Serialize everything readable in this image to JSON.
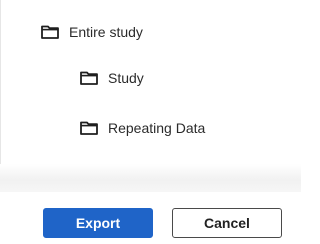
{
  "tree": {
    "items": [
      {
        "label": "Entire study",
        "icon": "folder-icon"
      },
      {
        "label": "Study",
        "icon": "folder-icon"
      },
      {
        "label": "Repeating Data",
        "icon": "folder-icon"
      }
    ]
  },
  "footer": {
    "export_label": "Export",
    "cancel_label": "Cancel"
  },
  "colors": {
    "primary": "#1f64c8",
    "text": "#2b2b2b",
    "icon": "#1e1e1e"
  }
}
